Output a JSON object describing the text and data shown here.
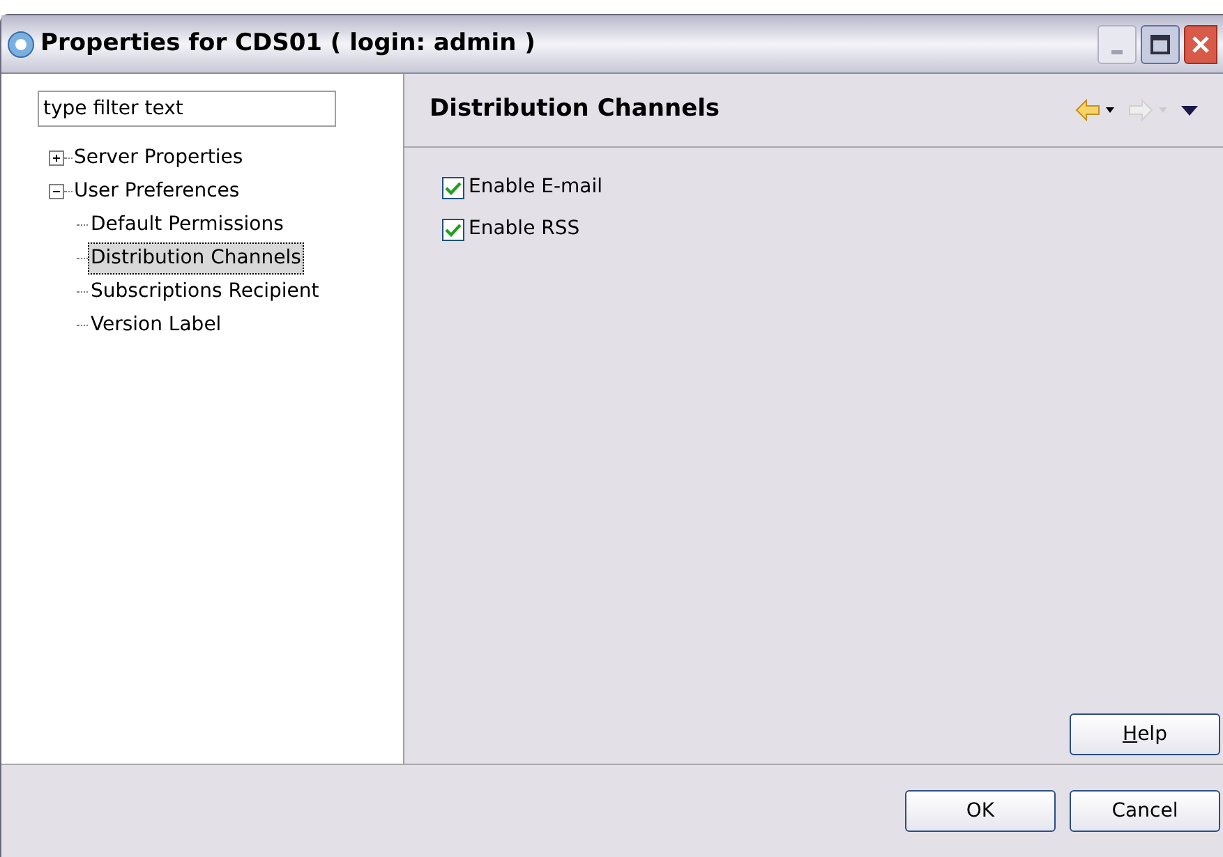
{
  "window": {
    "title": "Properties for CDS01 ( login: admin )"
  },
  "filter": {
    "placeholder": "type filter text"
  },
  "tree": [
    {
      "label": "Server Properties",
      "expanded": false,
      "selected": false
    },
    {
      "label": "User Preferences",
      "expanded": true,
      "selected": false,
      "children": [
        {
          "label": "Default Permissions",
          "selected": false
        },
        {
          "label": "Distribution Channels",
          "selected": true
        },
        {
          "label": "Subscriptions Recipient",
          "selected": false
        },
        {
          "label": "Version Label",
          "selected": false
        }
      ]
    }
  ],
  "page": {
    "title": "Distribution Channels",
    "back_enabled": true,
    "forward_enabled": false
  },
  "options": [
    {
      "label": "Enable E-mail",
      "checked": true
    },
    {
      "label": "Enable RSS",
      "checked": true
    }
  ],
  "help_button": {
    "label": "Help",
    "underline_first": true
  },
  "buttons": [
    "OK",
    "Cancel"
  ]
}
